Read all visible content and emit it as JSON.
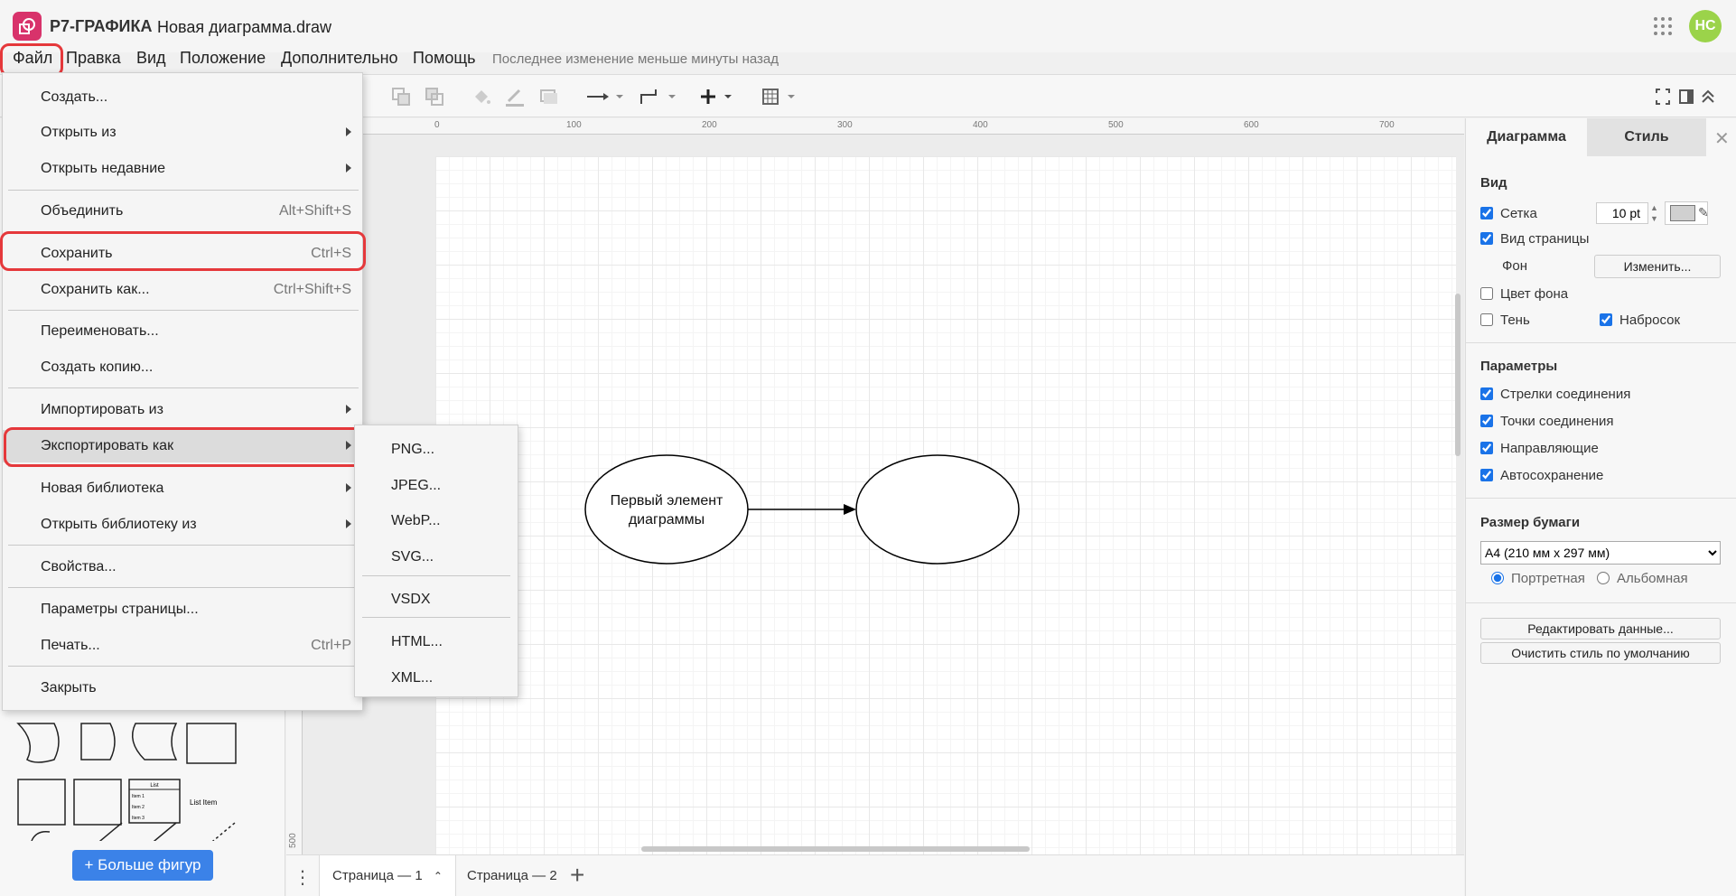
{
  "app": {
    "name": "Р7-ГРАФИКА",
    "document_title": "Новая диаграмма.draw",
    "user_initials": "НС",
    "brand_color": "#d8336b",
    "avatar_color": "#9bd34a"
  },
  "menubar": {
    "items": [
      "Файл",
      "Правка",
      "Вид",
      "Положение",
      "Дополнительно",
      "Помощь"
    ],
    "last_change": "Последнее изменение меньше минуты назад"
  },
  "file_menu": {
    "items": [
      {
        "label": "Создать...",
        "shortcut": "",
        "submenu": false
      },
      {
        "label": "Открыть из",
        "shortcut": "",
        "submenu": true
      },
      {
        "label": "Открыть недавние",
        "shortcut": "",
        "submenu": true
      },
      {
        "label": "Объединить",
        "shortcut": "Alt+Shift+S",
        "submenu": false
      },
      {
        "label": "Сохранить",
        "shortcut": "Ctrl+S",
        "submenu": false
      },
      {
        "label": "Сохранить как...",
        "shortcut": "Ctrl+Shift+S",
        "submenu": false
      },
      {
        "label": "Переименовать...",
        "shortcut": "",
        "submenu": false
      },
      {
        "label": "Создать копию...",
        "shortcut": "",
        "submenu": false
      },
      {
        "label": "Импортировать из",
        "shortcut": "",
        "submenu": true
      },
      {
        "label": "Экспортировать как",
        "shortcut": "",
        "submenu": true
      },
      {
        "label": "Новая библиотека",
        "shortcut": "",
        "submenu": true
      },
      {
        "label": "Открыть библиотеку из",
        "shortcut": "",
        "submenu": true
      },
      {
        "label": "Свойства...",
        "shortcut": "",
        "submenu": false
      },
      {
        "label": "Параметры страницы...",
        "shortcut": "",
        "submenu": false
      },
      {
        "label": "Печать...",
        "shortcut": "Ctrl+P",
        "submenu": false
      },
      {
        "label": "Закрыть",
        "shortcut": "",
        "submenu": false
      }
    ]
  },
  "export_menu": {
    "items": [
      "PNG...",
      "JPEG...",
      "WebP...",
      "SVG...",
      "VSDX",
      "HTML...",
      "XML..."
    ]
  },
  "canvas": {
    "ruler_labels": [
      "0",
      "100",
      "200",
      "300",
      "400",
      "500",
      "600",
      "700"
    ],
    "ruler_left_label": "500",
    "shape1_text": "Первый элемент диаграммы"
  },
  "left_panel": {
    "more_shapes_label": "+ Больше фигур",
    "list_item_label": "List Item",
    "list_header": "List",
    "list_rows": [
      "Item 1",
      "Item 2",
      "Item 3"
    ]
  },
  "pages": {
    "tabs": [
      "Страница — 1",
      "Страница — 2"
    ],
    "active": "Страница — 1"
  },
  "right_panel": {
    "tabs": [
      "Диаграмма",
      "Стиль"
    ],
    "view_heading": "Вид",
    "grid_label": "Сетка",
    "grid_checked": true,
    "grid_size": "10 pt",
    "page_view_label": "Вид страницы",
    "page_view_checked": true,
    "background_label": "Фон",
    "change_button": "Изменить...",
    "bg_color_label": "Цвет фона",
    "bg_color_checked": false,
    "shadow_label": "Тень",
    "shadow_checked": false,
    "sketch_label": "Набросок",
    "sketch_checked": true,
    "params_heading": "Параметры",
    "params": [
      {
        "label": "Стрелки соединения",
        "checked": true
      },
      {
        "label": "Точки соединения",
        "checked": true
      },
      {
        "label": "Направляющие",
        "checked": true
      },
      {
        "label": "Автосохранение",
        "checked": true
      }
    ],
    "paper_heading": "Размер бумаги",
    "paper_size": "A4 (210 мм x 297 мм)",
    "portrait_label": "Портретная",
    "landscape_label": "Альбомная",
    "edit_data_button": "Редактировать данные...",
    "clear_style_button": "Очистить стиль по умолчанию"
  }
}
